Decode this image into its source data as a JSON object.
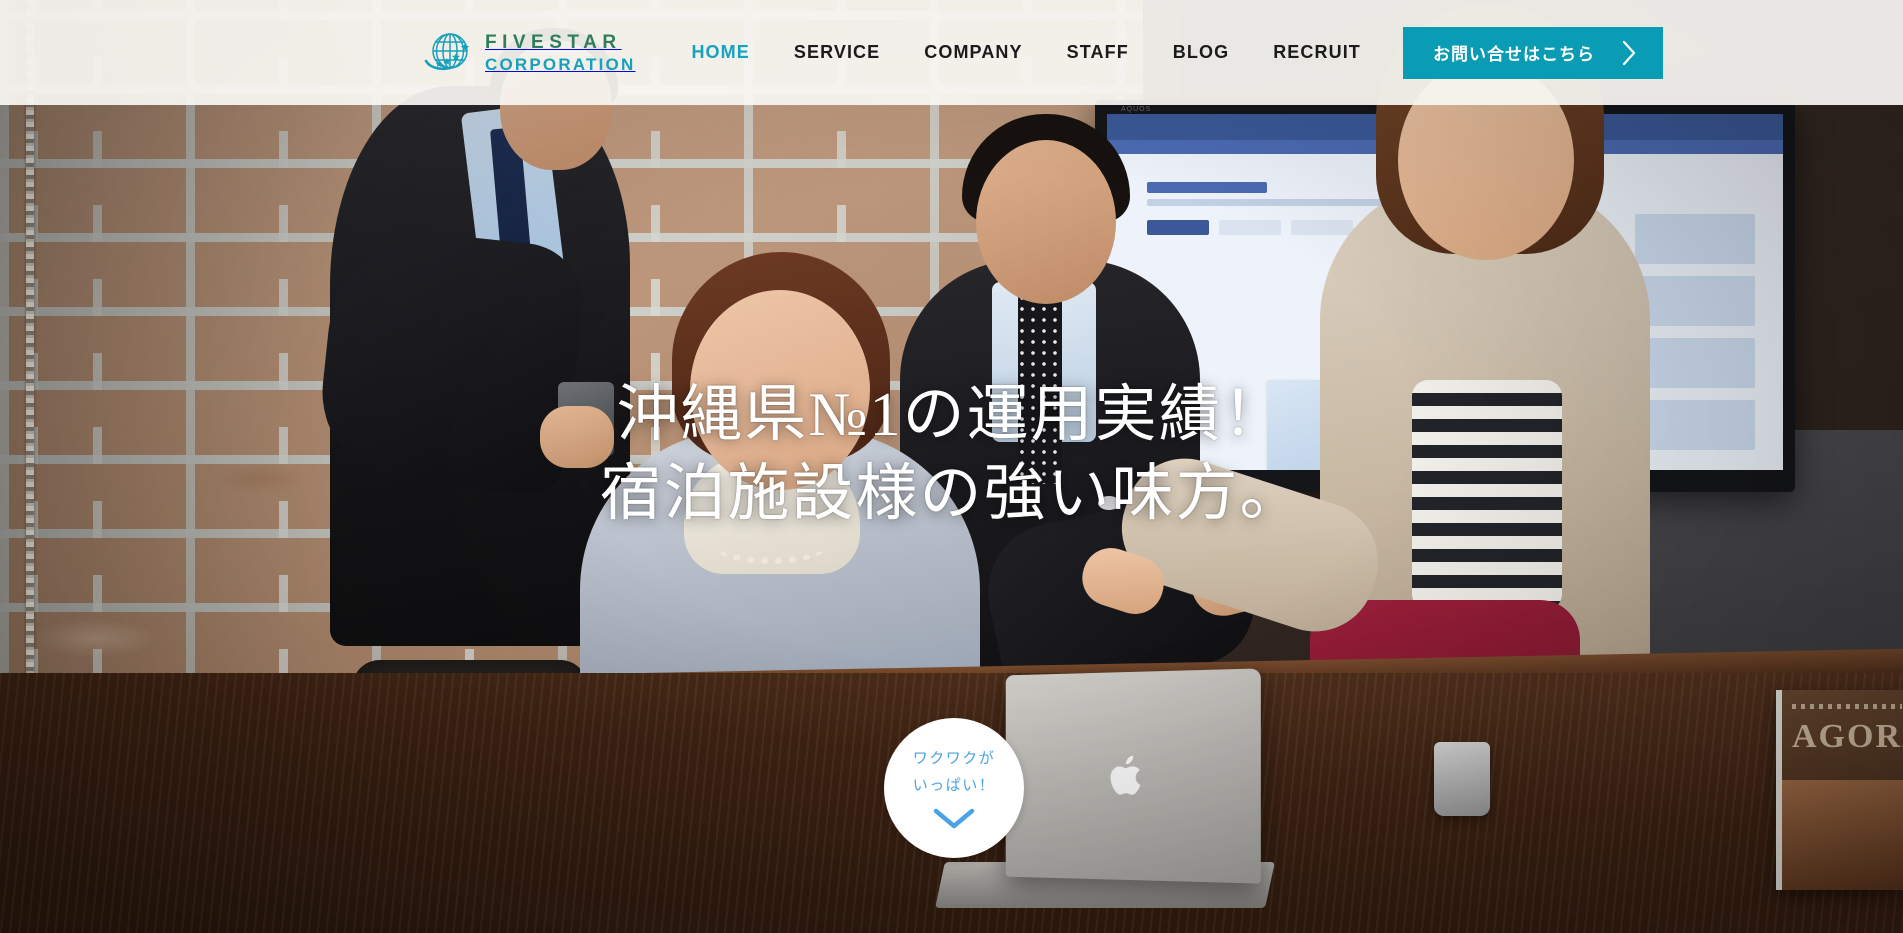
{
  "header": {
    "brand": {
      "icon": "globe-star-logo",
      "line1": "FIVESTAR",
      "line2": "CORPORATION"
    },
    "nav": [
      {
        "label": "HOME",
        "active": true
      },
      {
        "label": "SERVICE",
        "active": false
      },
      {
        "label": "COMPANY",
        "active": false
      },
      {
        "label": "STAFF",
        "active": false
      },
      {
        "label": "BLOG",
        "active": false
      },
      {
        "label": "RECRUIT",
        "active": false
      }
    ],
    "cta": {
      "label": "お問い合せはこちら",
      "icon": "chevron-right-icon",
      "bg_color": "#0a9cb4",
      "text_color": "#ffffff"
    },
    "bg_color": "#f8f6f2",
    "active_link_color": "#17a2bf",
    "link_color": "#1b1b1b"
  },
  "hero": {
    "headline_line1": "沖縄県№1の運用実績！",
    "headline_line2": "宿泊施設様の強い味方。",
    "text_color": "#ffffff",
    "scroll_badge": {
      "line1": "ワクワクが",
      "line2": "いっぱい！",
      "icon": "chevron-down-icon",
      "text_color": "#4aa3e4",
      "bg_color": "#ffffff"
    },
    "photo": {
      "description": "office-team-meeting-photo",
      "tv_label": "AQUOS",
      "magazine_title": "AGORA"
    }
  }
}
